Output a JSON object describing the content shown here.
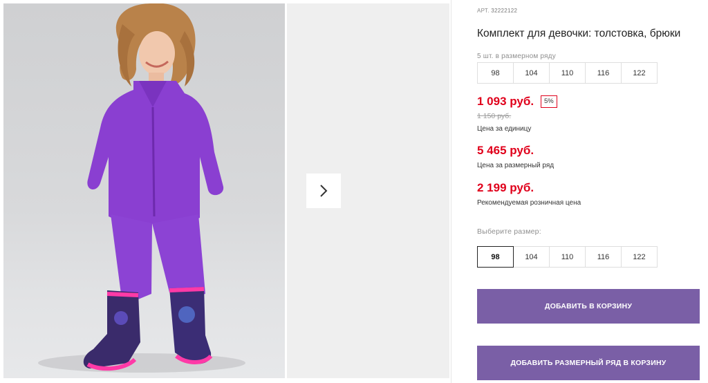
{
  "product": {
    "article_label": "АРТ.",
    "article_value": "32222122",
    "title": "Комплект для девочки: толстовка, брюки",
    "size_row_caption": "5 шт. в размерном ряду",
    "size_row": [
      "98",
      "104",
      "110",
      "116",
      "122"
    ],
    "unit_price": "1 093 руб.",
    "discount": "5%",
    "old_price": "1 150 руб.",
    "unit_price_caption": "Цена за единицу",
    "row_price": "5 465 руб.",
    "row_price_caption": "Цена за размерный ряд",
    "retail_price": "2 199 руб.",
    "retail_price_caption": "Рекомендуемая розничная цена",
    "choose_size_label": "Выберите размер:",
    "sizes": [
      "98",
      "104",
      "110",
      "116",
      "122"
    ],
    "selected_size": "98",
    "add_to_cart": "ДОБАВИТЬ В КОРЗИНУ",
    "add_row_to_cart": "ДОБАВИТЬ РАЗМЕРНЫЙ РЯД В КОРЗИНУ"
  },
  "gallery": {
    "next_icon": "chevron-right-icon"
  },
  "colors": {
    "accent_button": "#7a5fa6",
    "price_red": "#e0001b",
    "fleece_purple": "#8a3fd1"
  }
}
